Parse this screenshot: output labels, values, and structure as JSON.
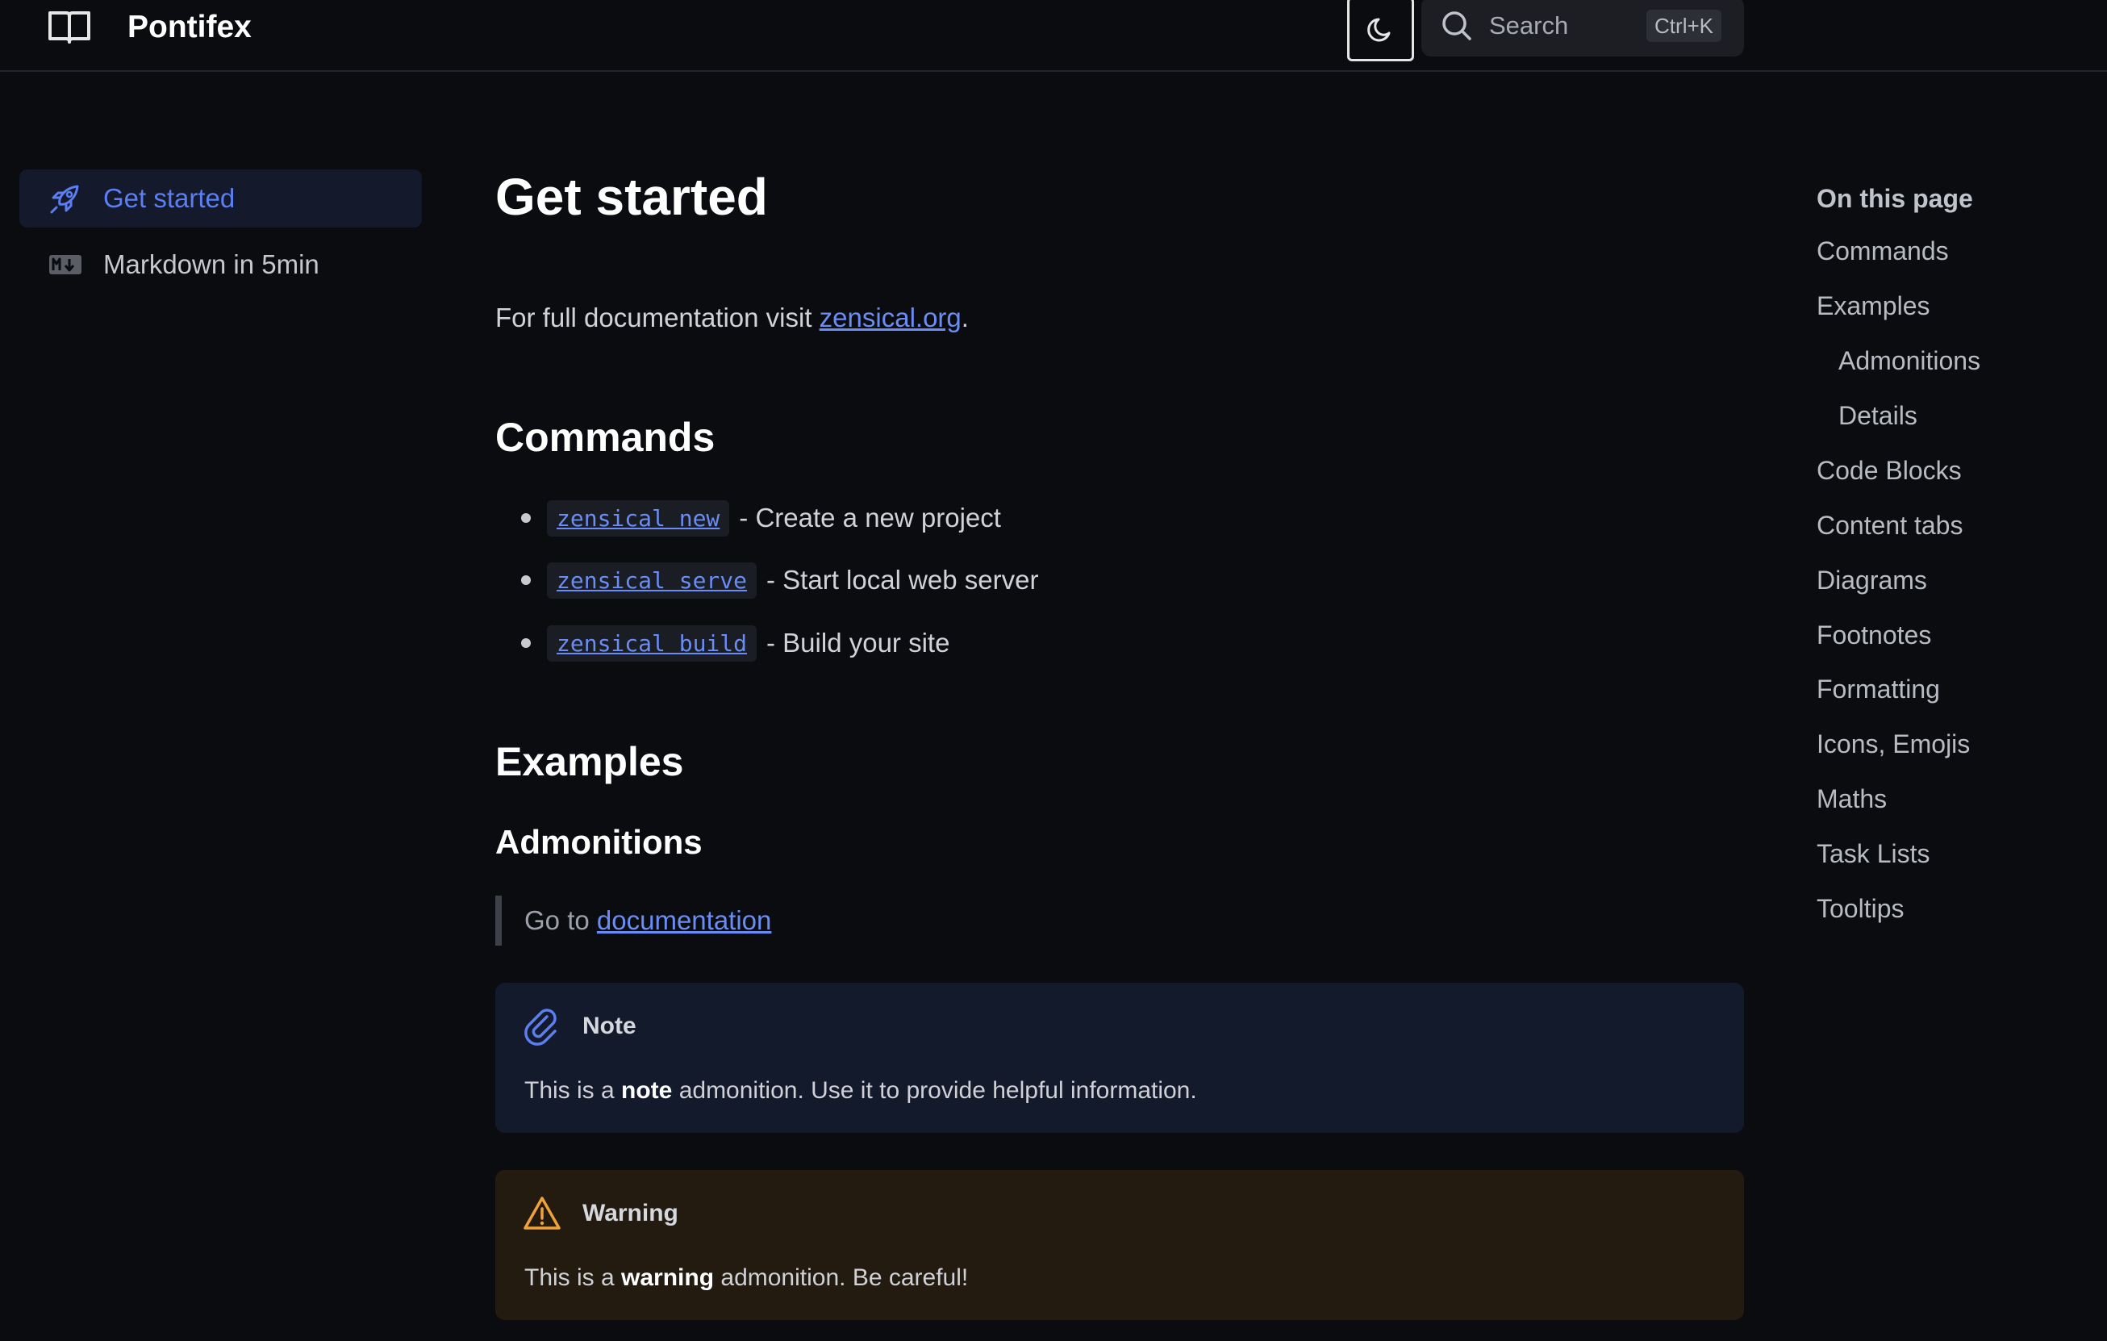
{
  "header": {
    "site_title": "Pontifex",
    "search_label": "Search",
    "search_shortcut": "Ctrl+K"
  },
  "sidebar": {
    "items": [
      {
        "label": "Get started",
        "icon": "rocket-icon",
        "active": true
      },
      {
        "label": "Markdown in 5min",
        "icon": "markdown-icon",
        "active": false
      }
    ]
  },
  "main": {
    "title": "Get started",
    "intro_prefix": "For full documentation visit ",
    "intro_link": "zensical.org",
    "intro_suffix": ".",
    "commands_heading": "Commands",
    "commands": [
      {
        "code": "zensical new",
        "desc": "- Create a new project"
      },
      {
        "code": "zensical serve",
        "desc": "- Start local web server"
      },
      {
        "code": "zensical build",
        "desc": "- Build your site"
      }
    ],
    "examples_heading": "Examples",
    "admonitions_heading": "Admonitions",
    "quote_prefix": "Go to ",
    "quote_link": "documentation",
    "note": {
      "title": "Note",
      "body_prefix": "This is a ",
      "body_bold": "note",
      "body_suffix": " admonition. Use it to provide helpful information."
    },
    "warning": {
      "title": "Warning",
      "body_prefix": "This is a ",
      "body_bold": "warning",
      "body_suffix": " admonition. Be careful!"
    }
  },
  "toc": {
    "title": "On this page",
    "items": [
      {
        "label": "Commands",
        "indent": false
      },
      {
        "label": "Examples",
        "indent": false
      },
      {
        "label": "Admonitions",
        "indent": true
      },
      {
        "label": "Details",
        "indent": true
      },
      {
        "label": "Code Blocks",
        "indent": false
      },
      {
        "label": "Content tabs",
        "indent": false
      },
      {
        "label": "Diagrams",
        "indent": false
      },
      {
        "label": "Footnotes",
        "indent": false
      },
      {
        "label": "Formatting",
        "indent": false
      },
      {
        "label": "Icons, Emojis",
        "indent": false
      },
      {
        "label": "Maths",
        "indent": false
      },
      {
        "label": "Task Lists",
        "indent": false
      },
      {
        "label": "Tooltips",
        "indent": false
      }
    ]
  },
  "colors": {
    "background": "#0b0c10",
    "accent": "#6a8cf5",
    "note_bg": "#131a2b",
    "warning_bg": "#231b10",
    "warning_accent": "#f0a23a"
  }
}
